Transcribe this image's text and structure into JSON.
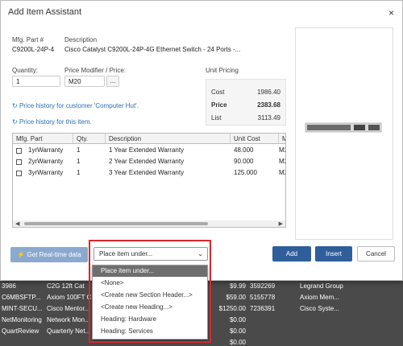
{
  "background_rows": [
    {
      "c1": "3986",
      "c2": "C2G 12ft Cat",
      "c3": "",
      "c4": "$9.99",
      "c5": "3592269",
      "c6": "Legrand Group"
    },
    {
      "c1": "C6MBSFTP...",
      "c2": "Axiom 100FT C...",
      "c3": "",
      "c4": "$59.00",
      "c5": "5155778",
      "c6": "Axiom Mem..."
    },
    {
      "c1": "MINT-SECU...",
      "c2": "Cisco Mentor...",
      "c3": "",
      "c4": "$1250.00",
      "c5": "7236391",
      "c6": "Cisco Syste..."
    },
    {
      "c1": "NetMonitoring",
      "c2": "Network Mon...",
      "c3": "",
      "c4": "$0.00",
      "c5": "",
      "c6": ""
    },
    {
      "c1": "QuartReview",
      "c2": "Quarterly Net...",
      "c3": "",
      "c4": "$0.00",
      "c5": "",
      "c6": ""
    },
    {
      "c1": "",
      "c2": "",
      "c3": "",
      "c4": "$0.00",
      "c5": "",
      "c6": ""
    }
  ],
  "dialog": {
    "title": "Add Item Assistant",
    "close": "×",
    "mfg_part_label": "Mfg. Part #",
    "mfg_part_value": "C9200L-24P-4",
    "description_label": "Description",
    "description_value": "Cisco Catalyst C9200L-24P-4G Ethernet Switch - 24 Ports -...",
    "quantity_label": "Quantity:",
    "quantity_value": "1",
    "price_modifier_label": "Price Modifier / Price:",
    "price_modifier_value": "M20",
    "price_modifier_button": "...",
    "unit_pricing_label": "Unit Pricing",
    "pricing": {
      "cost_label": "Cost",
      "cost_value": "1986.40",
      "price_label": "Price",
      "price_value": "2383.68",
      "list_label": "List",
      "list_value": "3113.49"
    },
    "link_customer_history": "Price history for customer 'Computer Hut'.",
    "link_item_history": "Price history for this item."
  },
  "table": {
    "headers": [
      "Mfg. Part",
      "Qty.",
      "Description",
      "Unit Cost",
      "M"
    ],
    "rows": [
      {
        "part": "1yrWarranty",
        "qty": "1",
        "desc": "1 Year Extended Warranty",
        "cost": "48.000",
        "m": "M2"
      },
      {
        "part": "2yrWarranty",
        "qty": "1",
        "desc": "2 Year Extended Warranty",
        "cost": "90.000",
        "m": "M2"
      },
      {
        "part": "3yrWarranty",
        "qty": "1",
        "desc": "3 Year Extended Warranty",
        "cost": "125.000",
        "m": "M2"
      }
    ]
  },
  "footer": {
    "realtime_label": "Get Real-time data",
    "place_select_value": "Place item under...",
    "add_label": "Add",
    "insert_label": "Insert",
    "cancel_label": "Cancel"
  },
  "dropdown": {
    "options": [
      "Place item under...",
      "<None>",
      "<Create new Section Header...>",
      "<Create new Heading...>",
      "Heading: Hardware",
      "Heading: Services"
    ],
    "selected_index": 0
  },
  "colors": {
    "highlight_box": "#d9272e",
    "primary_button": "#2f5f9a",
    "link": "#2a6fb0"
  }
}
